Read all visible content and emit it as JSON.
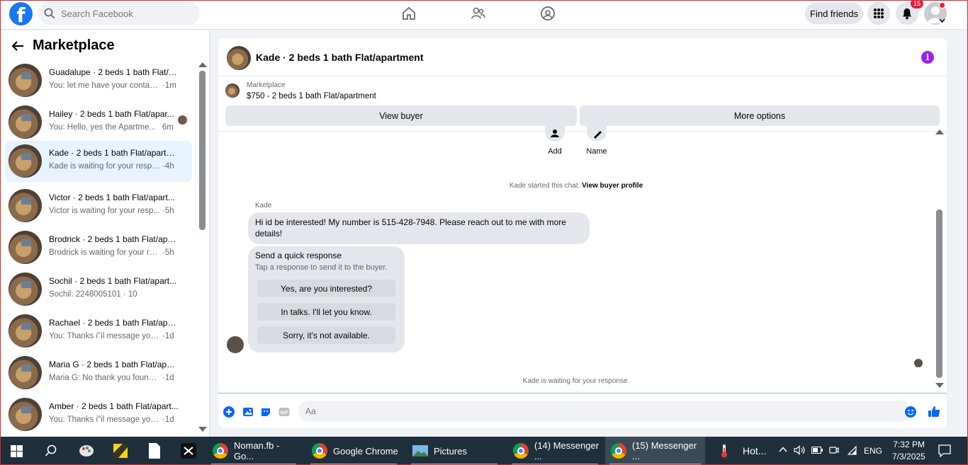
{
  "topbar": {
    "search_placeholder": "Search Facebook",
    "find_friends": "Find friends",
    "notification_count": "15"
  },
  "sidebar": {
    "title": "Marketplace",
    "conversations": [
      {
        "title": "Guadalupe · 2 beds 1 bath Flat/a...",
        "preview": "You: let me have your contact ...",
        "time": "·1m"
      },
      {
        "title": "Hailey · 2 beds 1 bath Flat/apar...",
        "preview": "You: Hello, yes the Apartme...",
        "time": "6m"
      },
      {
        "title": "Kade · 2 beds 1 bath Flat/apartm...",
        "preview": "Kade is waiting for your respo...",
        "time": "·4h"
      },
      {
        "title": "Victor · 2 beds 1 bath Flat/apart...",
        "preview": "Victor is waiting for your resp...",
        "time": "·5h"
      },
      {
        "title": "Brodrick · 2 beds 1 bath Flat/apar...",
        "preview": "Brodrick is waiting for your res...",
        "time": "·5h"
      },
      {
        "title": "Sochil · 2 beds 1 bath Flat/apart...",
        "preview": "Sochil: 2248005101 · 10",
        "time": ""
      },
      {
        "title": "Rachael · 2 beds 1 bath Flat/apart...",
        "preview": "You: Thanks i\"il message you i...",
        "time": "·1d"
      },
      {
        "title": "Maria G · 2 beds 1 bath Flat/apart...",
        "preview": "Maria G: No thank you found ...",
        "time": "·1d"
      },
      {
        "title": "Amber · 2 beds 1 bath Flat/apart...",
        "preview": "You: Thanks i\"il message you i...",
        "time": "·1d"
      }
    ]
  },
  "chat": {
    "title": "Kade · 2 beds 1 bath Flat/apartment",
    "listing_label": "Marketplace",
    "listing_price": "$750 - 2 beds 1 bath Flat/apartment",
    "view_buyer": "View buyer",
    "more_options": "More options",
    "action_add": "Add",
    "action_name": "Name",
    "system_text": "Kade started this chat.",
    "system_link": "View buyer profile",
    "sender": "Kade",
    "message": "Hi id be interested! My number is 515-428-7948. Please reach out to me with more details!",
    "quick_title": "Send a quick response",
    "quick_sub": "Tap a response to send it to the buyer.",
    "quick_options": [
      "Yes, are you interested?",
      "In talks. I'll let you know.",
      "Sorry, it's not available."
    ],
    "waiting": "Kade is waiting for your response.",
    "composer_placeholder": "Aa"
  },
  "taskbar": {
    "items": [
      "Noman.fb - Go...",
      "Google Chrome",
      "Pictures",
      "(14) Messenger ...",
      "(15) Messenger ..."
    ],
    "weather": "Hot...",
    "language": "ENG",
    "time": "7:32 PM",
    "date": "7/3/2025"
  },
  "colors": {
    "brand": "#1877f2",
    "info": "#9b21f0",
    "badge": "#e41e3f"
  }
}
